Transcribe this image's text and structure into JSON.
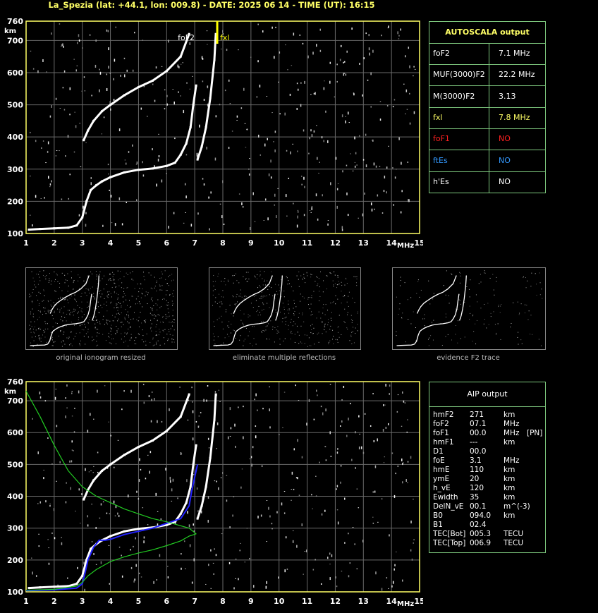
{
  "title": "La_Spezia (lat: +44.1, lon: 009.8) - DATE: 2025 06 14 - TIME (UT): 16:15",
  "chart_data": [
    {
      "type": "scatter",
      "ylabel": "km",
      "xlabel": "MHz",
      "xlim": [
        1,
        15
      ],
      "ylim": [
        100,
        760
      ],
      "x_ticks": [
        "1",
        "2",
        "3",
        "4",
        "5",
        "6",
        "7",
        "8",
        "9",
        "10",
        "11",
        "12",
        "13",
        "14",
        "15"
      ],
      "y_ticks": [
        "100",
        "200",
        "300",
        "400",
        "500",
        "600",
        "700",
        "760"
      ],
      "markers": [
        {
          "label": "foF2",
          "freq": 7.1,
          "color": "#ffffff"
        },
        {
          "label": "fxl",
          "freq": 7.8,
          "color": "#ffff00"
        }
      ],
      "traces": [
        {
          "x": [
            1.1,
            1.5,
            2.0,
            2.5,
            2.8,
            3.0,
            3.15,
            3.3,
            3.5,
            3.7,
            4.0,
            4.5,
            5.0,
            5.5,
            6.0,
            6.3,
            6.5,
            6.7,
            6.85,
            6.95,
            7.05
          ],
          "y": [
            112,
            114,
            116,
            118,
            125,
            150,
            200,
            235,
            250,
            262,
            275,
            290,
            298,
            302,
            310,
            320,
            345,
            380,
            430,
            500,
            560
          ]
        },
        {
          "x": [
            7.1,
            7.25,
            7.4,
            7.55,
            7.7,
            7.75
          ],
          "y": [
            330,
            370,
            430,
            520,
            640,
            720
          ]
        },
        {
          "x": [
            3.05,
            3.2,
            3.4,
            3.7,
            4.0,
            4.5,
            5.0,
            5.5,
            6.0,
            6.5,
            6.8
          ],
          "y": [
            390,
            420,
            450,
            480,
            500,
            530,
            555,
            575,
            605,
            650,
            720
          ]
        }
      ]
    },
    {
      "type": "line",
      "ylabel": "km",
      "xlabel": "MHz",
      "xlim": [
        1,
        15
      ],
      "ylim": [
        100,
        760
      ],
      "x_ticks": [
        "1",
        "2",
        "3",
        "4",
        "5",
        "6",
        "7",
        "8",
        "9",
        "10",
        "11",
        "12",
        "13",
        "14",
        "15"
      ],
      "y_ticks": [
        "100",
        "200",
        "300",
        "400",
        "500",
        "600",
        "700",
        "760"
      ],
      "series": [
        {
          "color": "#2222ff",
          "x": [
            1.0,
            2.0,
            2.8,
            3.0,
            3.1,
            3.2,
            3.4,
            3.6,
            3.8,
            4.0,
            4.5,
            5.0,
            5.5,
            6.0,
            6.5,
            6.8,
            6.9,
            7.0,
            7.1
          ],
          "y": [
            104,
            106,
            112,
            125,
            160,
            200,
            240,
            262,
            262,
            265,
            280,
            290,
            300,
            315,
            330,
            370,
            420,
            460,
            500
          ]
        },
        {
          "color": "#22cc22",
          "x": [
            1.0,
            2.0,
            2.8,
            3.0,
            3.2,
            3.5,
            4.0,
            4.5,
            5.0,
            5.5,
            6.0,
            6.5,
            6.8,
            7.05,
            6.8,
            6.0,
            5.5,
            5.0,
            4.5,
            4.0,
            3.5,
            3.0,
            2.5,
            2.0,
            1.5,
            1.0
          ],
          "y": [
            105,
            108,
            118,
            130,
            150,
            170,
            195,
            210,
            222,
            232,
            245,
            260,
            275,
            282,
            300,
            320,
            330,
            345,
            360,
            380,
            400,
            430,
            480,
            560,
            650,
            730
          ]
        }
      ]
    }
  ],
  "autoscala": {
    "header": "AUTOSCALA output",
    "rows": [
      {
        "label": "foF2",
        "value": "7.1 MHz",
        "color": "#ffffff",
        "vcolor": "#ffffff"
      },
      {
        "label": "MUF(3000)F2",
        "value": "22.2 MHz",
        "color": "#ffffff",
        "vcolor": "#ffffff"
      },
      {
        "label": "M(3000)F2",
        "value": "3.13",
        "color": "#ffffff",
        "vcolor": "#ffffff"
      },
      {
        "label": "fxl",
        "value": "7.8 MHz",
        "color": "#ffff66",
        "vcolor": "#ffff66"
      },
      {
        "label": "foF1",
        "value": "NO",
        "color": "#ff2020",
        "vcolor": "#ff2020"
      },
      {
        "label": "ftEs",
        "value": "NO",
        "color": "#3399ff",
        "vcolor": "#3399ff"
      },
      {
        "label": "h'Es",
        "value": "NO",
        "color": "#ffffff",
        "vcolor": "#ffffff"
      }
    ]
  },
  "aip": {
    "header": "AIP output",
    "rows": [
      [
        "hmF2",
        "271",
        "km",
        ""
      ],
      [
        "foF2",
        "07.1",
        "MHz",
        ""
      ],
      [
        "foF1",
        "00.0",
        "MHz",
        "[PN]"
      ],
      [
        "hmF1",
        "---",
        "km",
        ""
      ],
      [
        "D1",
        "00.0",
        "",
        ""
      ],
      [
        "foE",
        "3.1",
        "MHz",
        ""
      ],
      [
        "hmE",
        "110",
        "km",
        ""
      ],
      [
        "ymE",
        "20",
        "km",
        ""
      ],
      [
        "h_vE",
        "120",
        "km",
        ""
      ],
      [
        "Ewidth",
        "35",
        "km",
        ""
      ],
      [
        "DelN_vE",
        "00.1",
        "m^(-3)",
        ""
      ],
      [
        "B0",
        "094.0",
        "km",
        ""
      ],
      [
        "B1",
        "02.4",
        "",
        ""
      ],
      [
        "TEC[Bot]",
        "005.3",
        "TECU",
        ""
      ],
      [
        "TEC[Top]",
        "006.9",
        "TECU",
        ""
      ]
    ]
  },
  "thumbnails": [
    {
      "caption": "original ionogram resized"
    },
    {
      "caption": "eliminate multiple reflections"
    },
    {
      "caption": "evidence F2 trace"
    }
  ]
}
